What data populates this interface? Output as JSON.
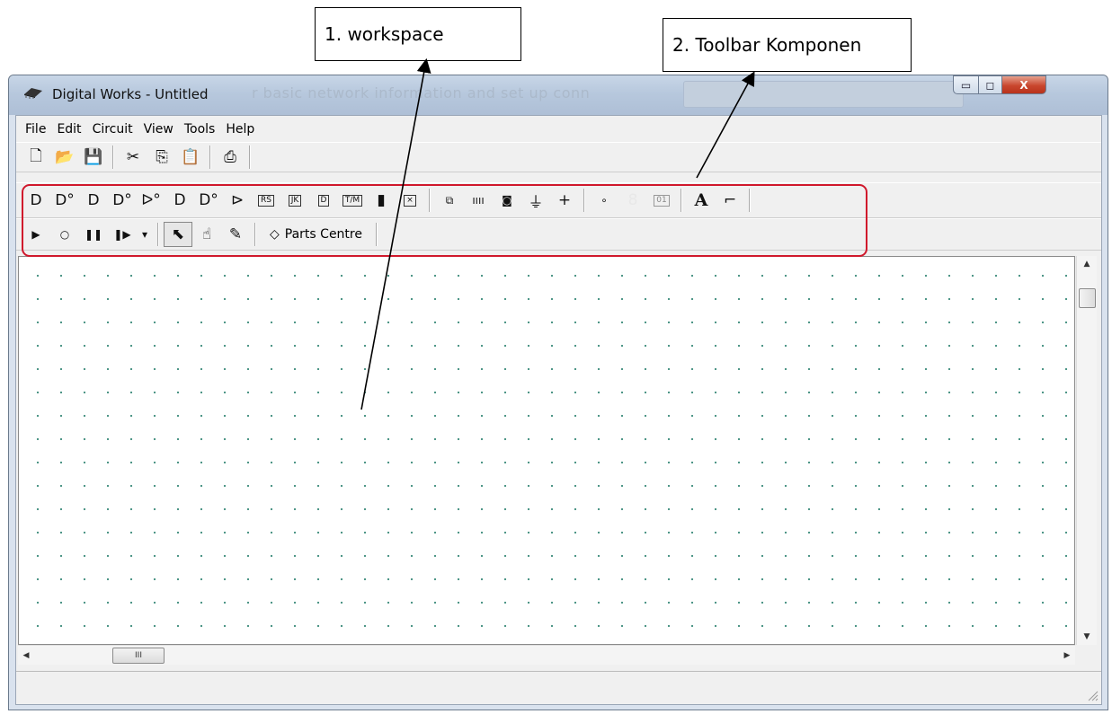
{
  "annotations": {
    "workspace_label": "1. workspace",
    "toolbar_label": "2. Toolbar Komponen"
  },
  "window": {
    "title": "Digital Works - Untitled",
    "background_title_text": "r basic network information and set up conn",
    "controls": {
      "minimize": "▭",
      "maximize": "◻",
      "close": "X"
    }
  },
  "menu": [
    "File",
    "Edit",
    "Circuit",
    "View",
    "Tools",
    "Help"
  ],
  "file_toolbar": [
    {
      "name": "new-icon",
      "glyph": "🗋"
    },
    {
      "name": "open-icon",
      "glyph": "📂"
    },
    {
      "name": "save-icon",
      "glyph": "💾"
    },
    {
      "name": "cut-icon",
      "glyph": "✂"
    },
    {
      "name": "copy-icon",
      "glyph": "⎘"
    },
    {
      "name": "paste-icon",
      "glyph": "📋"
    },
    {
      "name": "print-icon",
      "glyph": "⎙"
    }
  ],
  "parts_toolbar": {
    "gates": [
      "ᗞ",
      "ᗞ°",
      "ᗞ",
      "ᗞ°",
      "ᐅ°",
      "D",
      "D°",
      "⊳"
    ],
    "flipflops": [
      "RS",
      "JK",
      "D",
      "T/M",
      "▮",
      "×"
    ],
    "sources": [
      "⧉",
      "ıııı",
      "◙",
      "⏚",
      "+"
    ],
    "outputs": [
      "∘",
      "8",
      "01"
    ],
    "text_tool": "A",
    "wire_tool": "⌐"
  },
  "sim_toolbar": {
    "controls": [
      "▶",
      "○",
      "❚❚",
      "❚▶",
      "▾"
    ],
    "modes": [
      "⬉",
      "☝",
      "✎"
    ],
    "parts_centre_label": "Parts Centre",
    "parts_centre_icon": "◇"
  },
  "scrollbars": {
    "h_thumb_grip": "III"
  },
  "colors": {
    "highlight_box": "#d0182c",
    "grid_dot": "#3a8a7a"
  }
}
